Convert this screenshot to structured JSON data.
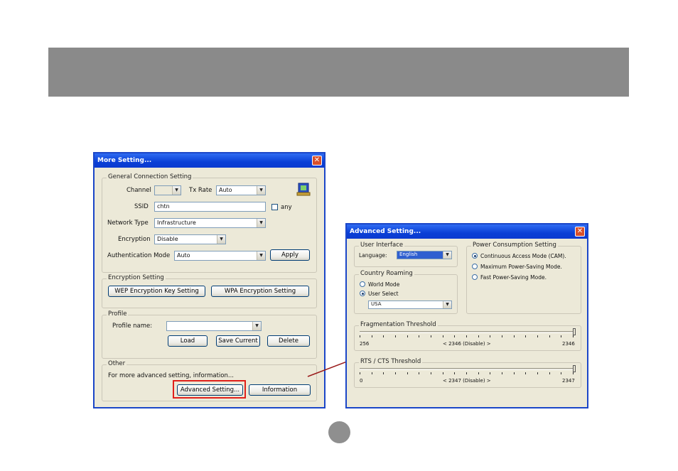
{
  "more_setting": {
    "title": "More Setting...",
    "close_glyph": "✕",
    "general": {
      "title": "General Connection Setting",
      "channel_label": "Channel",
      "channel_value": "",
      "tx_rate_label": "Tx Rate",
      "tx_rate_value": "Auto",
      "ssid_label": "SSID",
      "ssid_value": "chtn",
      "any_label": "any",
      "network_type_label": "Network Type",
      "network_type_value": "Infrastructure",
      "encryption_label": "Encryption",
      "encryption_value": "Disable",
      "auth_mode_label": "Authentication Mode",
      "auth_mode_value": "Auto",
      "apply_label": "Apply"
    },
    "encryption": {
      "title": "Encryption Setting",
      "wep_label": "WEP Encryption Key Setting",
      "wpa_label": "WPA Encryption Setting"
    },
    "profile": {
      "title": "Profile",
      "name_label": "Profile name:",
      "name_value": "",
      "load_label": "Load",
      "save_label": "Save Current",
      "delete_label": "Delete"
    },
    "other": {
      "title": "Other",
      "desc": "For more advanced setting, information...",
      "advanced_label": "Advanced Setting...",
      "info_label": "Information"
    }
  },
  "advanced_setting": {
    "title": "Advanced Setting...",
    "close_glyph": "✕",
    "ui": {
      "title": "User Interface",
      "language_label": "Language:",
      "language_value": "English"
    },
    "roaming": {
      "title": "Country Roaming",
      "world_label": "World Mode",
      "user_label": "User Select",
      "selected": "User Select",
      "country_value": "USA"
    },
    "power": {
      "title": "Power Consumption Setting",
      "options": [
        "Continuous Access Mode (CAM).",
        "Maximum Power-Saving Mode.",
        "Fast Power-Saving Mode."
      ],
      "selected_index": 0
    },
    "frag": {
      "title": "Fragmentation Threshold",
      "min_label": "256",
      "value_label": "< 2346 (Disable) >",
      "max_label": "2346",
      "min": 256,
      "max": 2346,
      "value": 2346
    },
    "rts": {
      "title": "RTS / CTS Threshold",
      "min_label": "0",
      "value_label": "< 2347 (Disable) >",
      "max_label": "2347",
      "min": 0,
      "max": 2347,
      "value": 2347
    }
  },
  "colors": {
    "arrow": "#9a1c1c",
    "highlight": "#e0201a",
    "header_band": "#8a8a8a"
  }
}
